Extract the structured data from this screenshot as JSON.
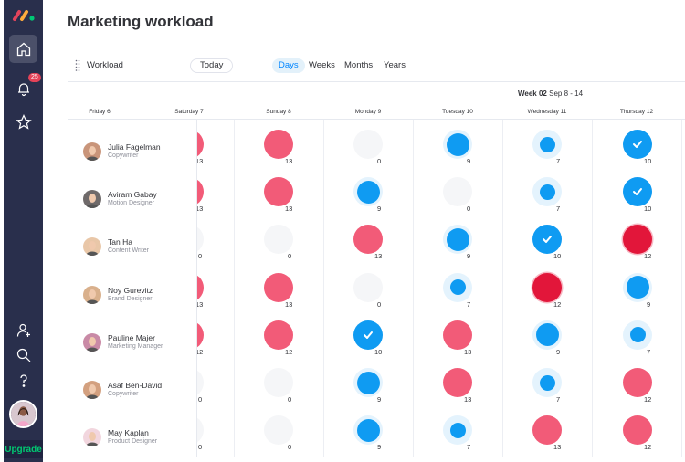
{
  "app": {
    "title": "Marketing workload",
    "brand_colors": [
      "#e2445c",
      "#fdab3d",
      "#00c875"
    ]
  },
  "sidebar": {
    "notifications_badge": "25",
    "items": [
      {
        "name": "home",
        "icon": "home-icon",
        "active": true
      },
      {
        "name": "notifications",
        "icon": "bell-icon"
      },
      {
        "name": "favorites",
        "icon": "star-icon"
      },
      {
        "name": "invite",
        "icon": "add-user-icon"
      },
      {
        "name": "search",
        "icon": "search-icon"
      },
      {
        "name": "help",
        "icon": "help-icon"
      }
    ],
    "upgrade_label": "Upgrade"
  },
  "toolbar": {
    "widget_label": "Workload",
    "today_label": "Today",
    "views": [
      "Days",
      "Weeks",
      "Months",
      "Years"
    ],
    "active_view": "Days"
  },
  "calendar": {
    "week_bold": "Week 02",
    "week_range": "Sep 8 - 14",
    "days": [
      "Friday 6",
      "Saturday 7",
      "Sunday 8",
      "Monday 9",
      "Tuesday 10",
      "Wednesday 11",
      "Thursday 12"
    ]
  },
  "colors": {
    "over": "#f25b78",
    "critical": "#e2163a",
    "blue": "#0f9bf2",
    "empty": "#f5f6f8"
  },
  "people": [
    {
      "name": "Julia Fagelman",
      "role": "Copywriter",
      "load": [
        13,
        13,
        0,
        9,
        7,
        10
      ],
      "types": [
        "over",
        "over",
        "empty",
        "high",
        "mid",
        "full"
      ]
    },
    {
      "name": "Aviram Gabay",
      "role": "Motion Designer",
      "load": [
        13,
        13,
        9,
        0,
        7,
        10
      ],
      "types": [
        "over",
        "over",
        "high",
        "empty",
        "mid",
        "full"
      ]
    },
    {
      "name": "Tan Ha",
      "role": "Content Writer",
      "load": [
        0,
        0,
        13,
        9,
        10,
        12
      ],
      "types": [
        "empty",
        "empty",
        "over",
        "high",
        "full",
        "critical"
      ]
    },
    {
      "name": "Noy Gurevitz",
      "role": "Brand Designer",
      "load": [
        13,
        13,
        0,
        7,
        12,
        9
      ],
      "types": [
        "over",
        "over",
        "empty",
        "mid",
        "critical",
        "high"
      ]
    },
    {
      "name": "Pauline Majer",
      "role": "Marketing Manager",
      "load": [
        12,
        12,
        10,
        13,
        9,
        7
      ],
      "types": [
        "over",
        "over",
        "full",
        "over",
        "high",
        "mid"
      ]
    },
    {
      "name": "Asaf Ben-David",
      "role": "Copywriter",
      "load": [
        0,
        0,
        9,
        13,
        7,
        12
      ],
      "types": [
        "empty",
        "empty",
        "high",
        "over",
        "mid",
        "over"
      ]
    },
    {
      "name": "May Kaplan",
      "role": "Product Designer",
      "load": [
        0,
        0,
        9,
        7,
        13,
        12
      ],
      "types": [
        "empty",
        "empty",
        "high",
        "mid",
        "over",
        "over"
      ]
    }
  ]
}
